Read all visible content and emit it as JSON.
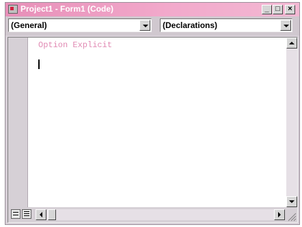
{
  "window": {
    "title": "Project1 - Form1 (Code)",
    "controls": {
      "minimize": "_",
      "maximize": "□",
      "close": "×"
    }
  },
  "toolbar": {
    "object_combo": {
      "value": "(General)"
    },
    "procedure_combo": {
      "value": "(Declarations)"
    }
  },
  "editor": {
    "code_lines": [
      "Option Explicit"
    ],
    "colors": {
      "comment_keyword_text": "#e18ab3",
      "title_gradient_start": "#e78fb8",
      "title_gradient_end": "#f3b8d3"
    }
  },
  "icons": {
    "app": "app-icon",
    "view_procedure": "procedure-view-icon",
    "view_full_module": "full-module-view-icon",
    "dropdown": "chevron-down-icon",
    "scroll_up": "arrow-up-icon",
    "scroll_down": "arrow-down-icon",
    "scroll_left": "arrow-left-icon",
    "scroll_right": "arrow-right-icon",
    "resize": "resize-grip-icon"
  }
}
